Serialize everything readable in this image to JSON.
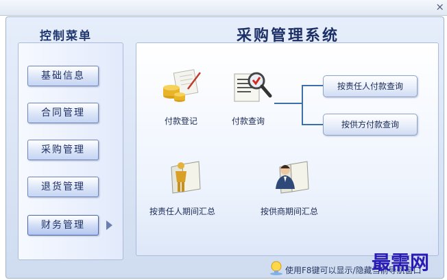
{
  "window": {
    "close_glyph": "×"
  },
  "sidebar": {
    "title": "控制菜单",
    "items": [
      {
        "label": "基础信息"
      },
      {
        "label": "合同管理"
      },
      {
        "label": "采购管理"
      },
      {
        "label": "退货管理"
      },
      {
        "label": "财务管理"
      }
    ]
  },
  "main": {
    "title": "采购管理系统",
    "functions": [
      {
        "label": "付款登记",
        "icon": "payment-register-icon"
      },
      {
        "label": "付款查询",
        "icon": "payment-query-icon"
      },
      {
        "label": "按责任人期间汇总",
        "icon": "person-period-summary-icon"
      },
      {
        "label": "按供商期间汇总",
        "icon": "supplier-period-summary-icon"
      }
    ],
    "query_buttons": [
      {
        "label": "按责任人付款查询"
      },
      {
        "label": "按供方付款查询"
      }
    ]
  },
  "status_bar": {
    "text": "使用F8键可以显示/隐藏当前导航窗口"
  },
  "watermark": {
    "text": "最需网"
  }
}
